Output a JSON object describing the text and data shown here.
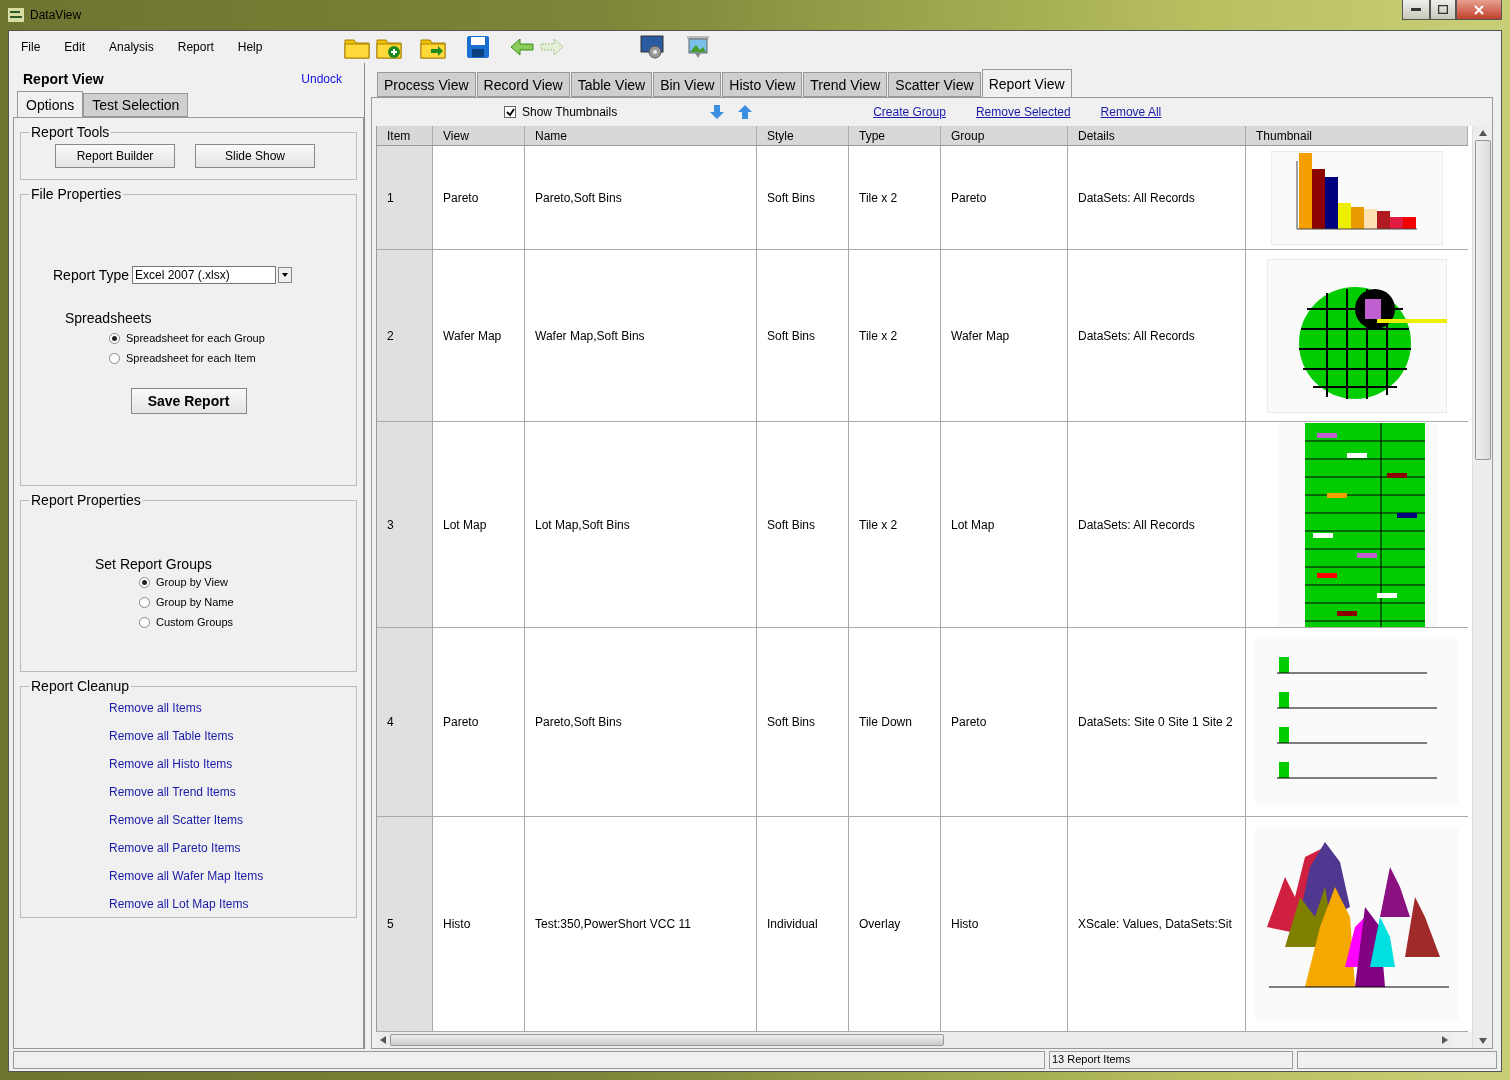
{
  "window": {
    "title": "DataView"
  },
  "menu": [
    "File",
    "Edit",
    "Analysis",
    "Report",
    "Help"
  ],
  "left_panel": {
    "title": "Report View",
    "undock": "Undock",
    "tabs": [
      {
        "label": "Options",
        "selected": true
      },
      {
        "label": "Test Selection",
        "selected": false
      }
    ],
    "report_tools": {
      "title": "Report Tools",
      "buttons": [
        "Report Builder",
        "Slide Show"
      ]
    },
    "file_properties": {
      "title": "File Properties",
      "report_type_label": "Report Type",
      "report_type_value": "Excel 2007 (.xlsx)",
      "spreadsheets_label": "Spreadsheets",
      "options": [
        {
          "label": "Spreadsheet for each Group",
          "selected": true
        },
        {
          "label": "Spreadsheet for each Item",
          "selected": false
        }
      ],
      "save_button": "Save Report"
    },
    "report_properties": {
      "title": "Report Properties",
      "groups_label": "Set Report Groups",
      "options": [
        {
          "label": "Group by View",
          "selected": true
        },
        {
          "label": "Group by Name",
          "selected": false
        },
        {
          "label": "Custom Groups",
          "selected": false
        }
      ]
    },
    "report_cleanup": {
      "title": "Report Cleanup",
      "links": [
        "Remove all Items",
        "Remove all Table Items",
        "Remove all Histo Items",
        "Remove all Trend Items",
        "Remove all Scatter Items",
        "Remove all Pareto Items",
        "Remove all Wafer Map Items",
        "Remove all Lot Map Items"
      ]
    }
  },
  "view_tabs": [
    {
      "label": "Process View",
      "selected": false
    },
    {
      "label": "Record View",
      "selected": false
    },
    {
      "label": "Table View",
      "selected": false
    },
    {
      "label": "Bin View",
      "selected": false
    },
    {
      "label": "Histo View",
      "selected": false
    },
    {
      "label": "Trend View",
      "selected": false
    },
    {
      "label": "Scatter View",
      "selected": false
    },
    {
      "label": "Report View",
      "selected": true
    }
  ],
  "show_thumbnails": {
    "label": "Show Thumbnails",
    "checked": true
  },
  "actions": [
    "Create Group",
    "Remove Selected",
    "Remove All"
  ],
  "table": {
    "columns": [
      "Item",
      "View",
      "Name",
      "Style",
      "Type",
      "Group",
      "Details",
      "Thumbnail"
    ],
    "rows": [
      {
        "item": "1",
        "view": "Pareto",
        "name": "Pareto,Soft Bins",
        "style": "Soft Bins",
        "type": "Tile x 2",
        "group": "Pareto",
        "details": "DataSets: All Records",
        "kind": "pareto"
      },
      {
        "item": "2",
        "view": "Wafer Map",
        "name": "Wafer Map,Soft Bins",
        "style": "Soft Bins",
        "type": "Tile x 2",
        "group": "Wafer Map",
        "details": "DataSets: All Records",
        "kind": "wafer"
      },
      {
        "item": "3",
        "view": "Lot Map",
        "name": "Lot Map,Soft Bins",
        "style": "Soft Bins",
        "type": "Tile x 2",
        "group": "Lot Map",
        "details": "DataSets: All Records",
        "kind": "lotmap"
      },
      {
        "item": "4",
        "view": "Pareto",
        "name": "Pareto,Soft Bins",
        "style": "Soft Bins",
        "type": "Tile Down",
        "group": "Pareto",
        "details": "DataSets: Site 0 Site 1 Site 2",
        "kind": "multipareto"
      },
      {
        "item": "5",
        "view": "Histo",
        "name": "Test:350,PowerShort VCC 11",
        "style": "Individual",
        "type": "Overlay",
        "group": "Histo",
        "details": "XScale: Values, DataSets:Sit",
        "kind": "histo"
      }
    ]
  },
  "status_bar": {
    "count": "13 Report Items"
  }
}
